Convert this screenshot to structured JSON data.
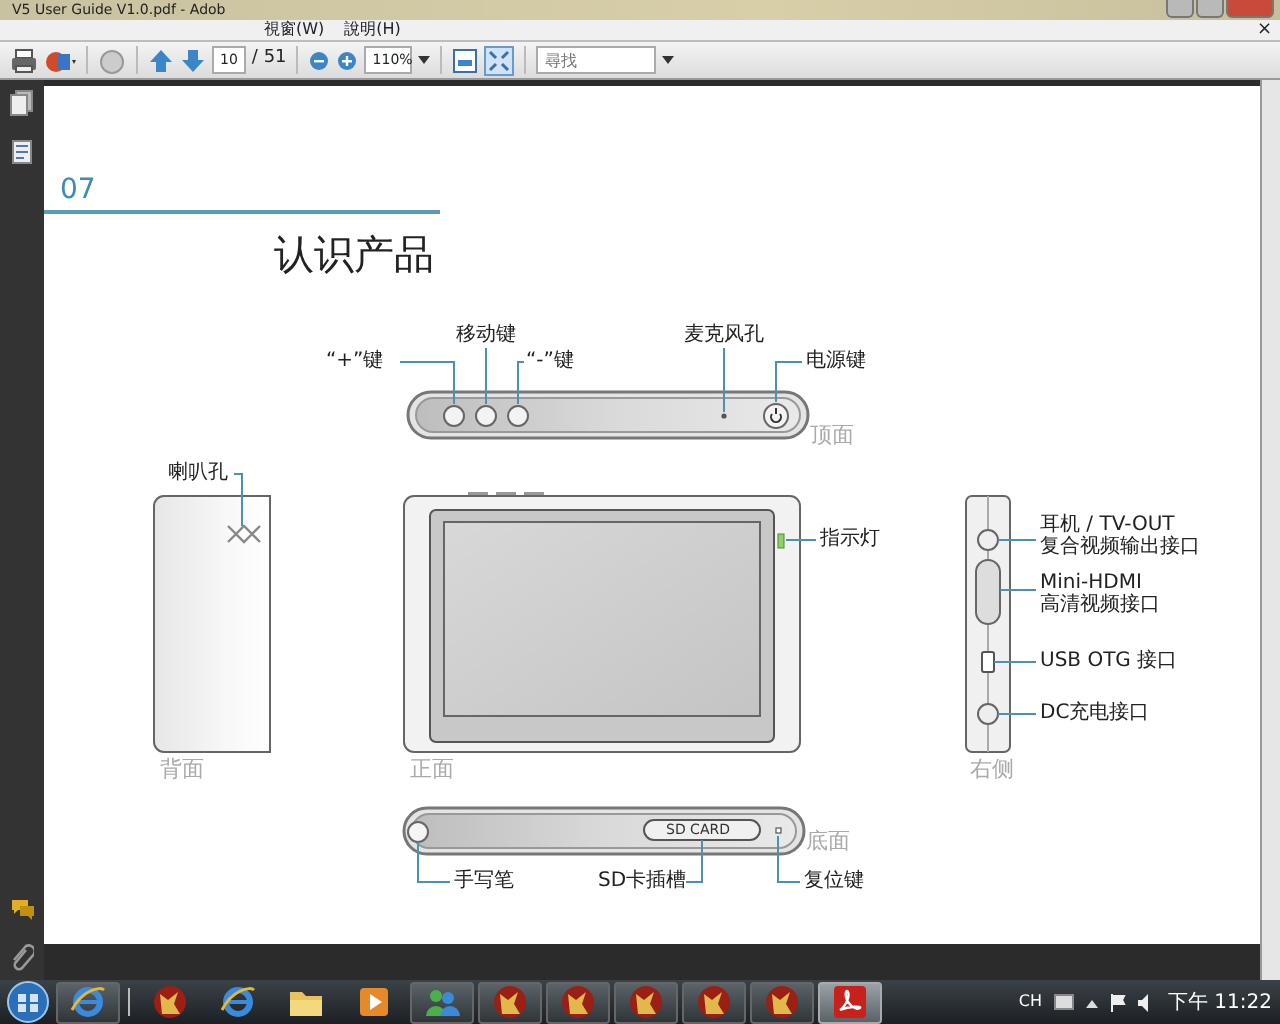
{
  "window": {
    "title": "V5 User Guide V1.0.pdf - Adob"
  },
  "menu": [
    "視窗(W)",
    "說明(H)"
  ],
  "document_close": "×",
  "toolbar": {
    "page": "10",
    "page_count": "/ 51",
    "zoom": "110%",
    "search_placeholder": "尋找"
  },
  "document": {
    "section": "07",
    "title": "认识产品",
    "views": [
      {
        "kind": "top",
        "caption": "顶面"
      },
      {
        "kind": "back",
        "caption": "背面"
      },
      {
        "kind": "front",
        "caption": "正面"
      },
      {
        "kind": "right",
        "caption": "右侧"
      },
      {
        "kind": "bottom",
        "caption": "底面"
      }
    ],
    "callouts": [
      {
        "text": "“+”键"
      },
      {
        "text": "移动键"
      },
      {
        "text": "“-”键"
      },
      {
        "text": "麦克风孔"
      },
      {
        "text": "电源键"
      },
      {
        "text": "喇叭孔"
      },
      {
        "text": "指示灯"
      },
      {
        "text": "耳机 / TV-OUT\n复合视频输出接口"
      },
      {
        "text": "Mini-HDMI\n高清视频接口"
      },
      {
        "text": "USB OTG 接口"
      },
      {
        "text": "DC充电接口"
      },
      {
        "text": "手写笔"
      },
      {
        "text": "SD卡插槽"
      },
      {
        "text": "复位键"
      }
    ],
    "card_slot_label": "SD CARD"
  },
  "taskbar": {
    "items": [
      {
        "kind": "ie",
        "running": true,
        "selected": false
      },
      {
        "kind": "game",
        "running": false,
        "selected": false
      },
      {
        "kind": "ie",
        "running": false,
        "selected": false
      },
      {
        "kind": "folder",
        "running": false,
        "selected": false
      },
      {
        "kind": "media",
        "running": false,
        "selected": false
      },
      {
        "kind": "messenger",
        "running": true,
        "selected": false
      },
      {
        "kind": "game",
        "running": true,
        "selected": false
      },
      {
        "kind": "game",
        "running": true,
        "selected": false
      },
      {
        "kind": "game",
        "running": true,
        "selected": false
      },
      {
        "kind": "game",
        "running": true,
        "selected": false
      },
      {
        "kind": "game",
        "running": true,
        "selected": false
      },
      {
        "kind": "acrobat",
        "running": true,
        "selected": true
      }
    ],
    "language": "CH",
    "clock": "下午 11:22"
  }
}
